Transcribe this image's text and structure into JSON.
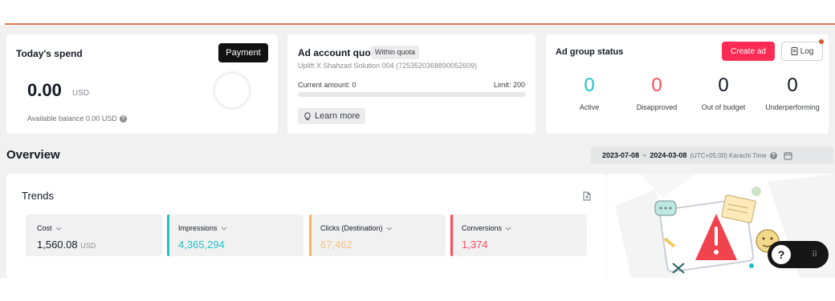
{
  "spend": {
    "title": "Today's spend",
    "payment_label": "Payment",
    "amount": "0.00",
    "currency": "USD",
    "balance_text": "Available balance 0.00 USD"
  },
  "quota": {
    "title": "Ad account quota",
    "badge": "Within quota",
    "account": "Uplift X Shahzad Solution 004 (7253520368890052609)",
    "current": "Current amount: 0",
    "limit": "Limit: 200",
    "progress": 0,
    "learn_more": "Learn more"
  },
  "group_status": {
    "title": "Ad group status",
    "create_label": "Create ad",
    "log_label": "Log",
    "stats": [
      {
        "value": "0",
        "label": "Active",
        "color": "#20c1c9"
      },
      {
        "value": "0",
        "label": "Disapproved",
        "color": "#fe4a5e"
      },
      {
        "value": "0",
        "label": "Out of budget",
        "color": "#161823"
      },
      {
        "value": "0",
        "label": "Underperforming",
        "color": "#161823"
      }
    ]
  },
  "overview": {
    "title": "Overview",
    "date_start": "2023-07-08",
    "date_sep": "~",
    "date_end": "2024-03-08",
    "timezone": "(UTC+05:00) Karachi Time"
  },
  "trends": {
    "title": "Trends",
    "metrics": [
      {
        "label": "Cost",
        "value": "1,560.08",
        "unit": "USD",
        "color": "#161823",
        "accent": ""
      },
      {
        "label": "Impressions",
        "value": "4,365,294",
        "unit": "",
        "color": "#20c1c9",
        "accent": "#20c1c9"
      },
      {
        "label": "Clicks (Destination)",
        "value": "67,462",
        "unit": "",
        "color": "#f8c07e",
        "accent": "#f8b365"
      },
      {
        "label": "Conversions",
        "value": "1,374",
        "unit": "",
        "color": "#fe4a5e",
        "accent": "#fe4a5e"
      }
    ]
  },
  "help": {
    "symbol": "?"
  }
}
